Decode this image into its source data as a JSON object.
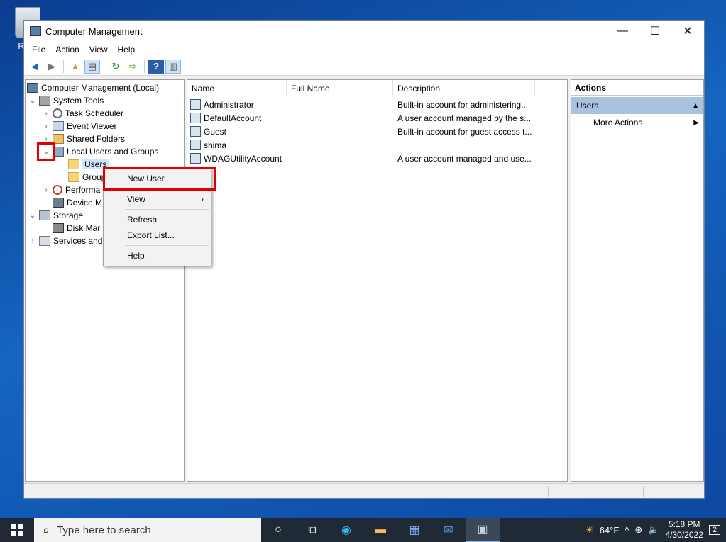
{
  "desktop": {
    "recycle_bin_label": "Recy"
  },
  "window": {
    "title": "Computer Management",
    "controls": {
      "minimize": "—",
      "maximize": "☐",
      "close": "✕"
    }
  },
  "menu": [
    "File",
    "Action",
    "View",
    "Help"
  ],
  "tree": {
    "root": "Computer Management (Local)",
    "system_tools": "System Tools",
    "task_scheduler": "Task Scheduler",
    "event_viewer": "Event Viewer",
    "shared_folders": "Shared Folders",
    "local_users_groups": "Local Users and Groups",
    "users": "Users",
    "groups": "Group",
    "performance": "Performa",
    "device_manager": "Device M",
    "storage": "Storage",
    "disk_management": "Disk Mar",
    "services": "Services and"
  },
  "list": {
    "columns": {
      "name": "Name",
      "full_name": "Full Name",
      "description": "Description"
    },
    "rows": [
      {
        "name": "Administrator",
        "full_name": "",
        "description": "Built-in account for administering..."
      },
      {
        "name": "DefaultAccount",
        "full_name": "",
        "description": "A user account managed by the s..."
      },
      {
        "name": "Guest",
        "full_name": "",
        "description": "Built-in account for guest access t..."
      },
      {
        "name": "shima",
        "full_name": "",
        "description": ""
      },
      {
        "name": "WDAGUtilityAccount",
        "full_name": "",
        "description": "A user account managed and use..."
      }
    ]
  },
  "actions": {
    "header": "Actions",
    "group": "Users",
    "more": "More Actions"
  },
  "context_menu": {
    "new_user": "New User...",
    "view": "View",
    "refresh": "Refresh",
    "export": "Export List...",
    "help": "Help"
  },
  "taskbar": {
    "search_placeholder": "Type here to search",
    "weather": "64°F",
    "time": "5:18 PM",
    "date": "4/30/2022",
    "notification_count": "2"
  },
  "colors": {
    "highlight": "#e00000",
    "selection": "#cce8ff",
    "actions_group": "#a8c2e0"
  }
}
